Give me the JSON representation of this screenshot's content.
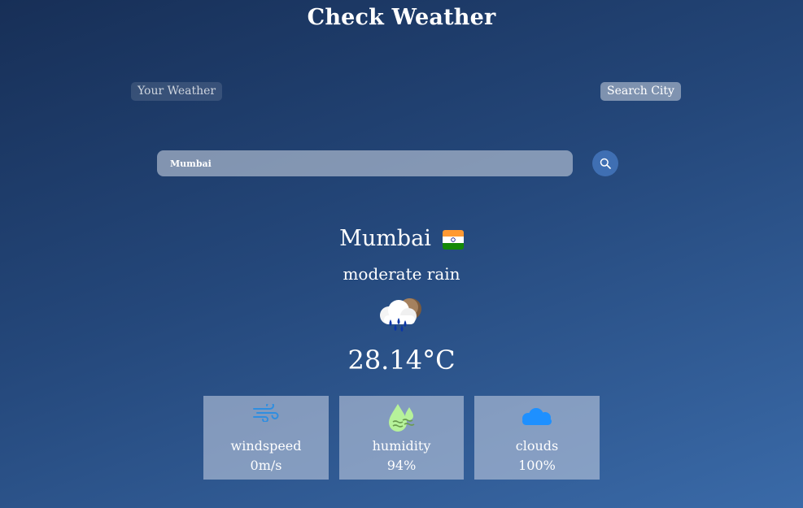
{
  "app": {
    "title": "Check Weather"
  },
  "tabs": {
    "your_weather": "Your Weather",
    "search_city": "Search City"
  },
  "search": {
    "value": "Mumbai",
    "placeholder": ""
  },
  "weather": {
    "city": "Mumbai",
    "flag_icon": "india-flag-icon",
    "condition": "moderate rain",
    "condition_icon": "cloud-rain-icon",
    "temperature": "28.14°C"
  },
  "stats": [
    {
      "label": "windspeed",
      "value": "0m/s",
      "icon": "wind-icon",
      "color": "#2f8ee0"
    },
    {
      "label": "humidity",
      "value": "94%",
      "icon": "humidity-drop-icon",
      "color": "#b6f29a"
    },
    {
      "label": "clouds",
      "value": "100%",
      "icon": "cloud-icon",
      "color": "#1e90ff"
    }
  ],
  "colors": {
    "background_top": "#172f57",
    "background_bottom": "#3a6aa8",
    "search_button": "#3f6fb3"
  }
}
